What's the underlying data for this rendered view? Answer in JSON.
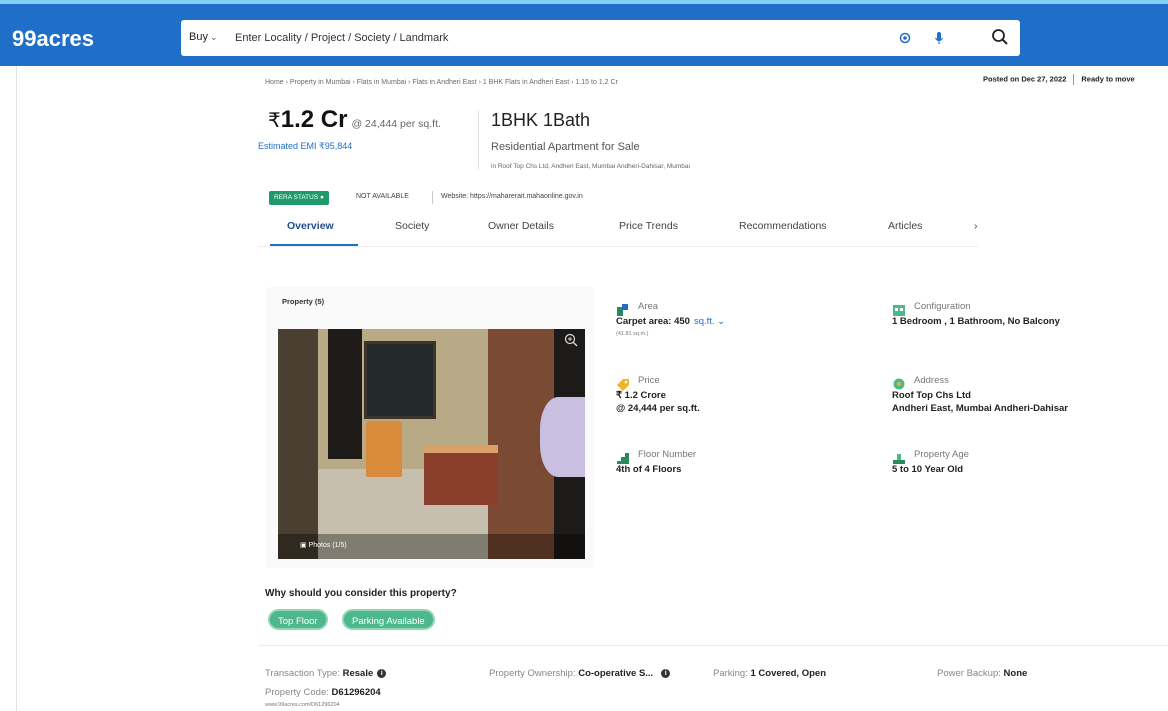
{
  "header": {
    "logo": "99acres",
    "buy_label": "Buy",
    "search_placeholder": "Enter Locality / Project / Society / Landmark"
  },
  "breadcrumb": "Home › Property in Mumbai › Flats in Mumbai › Flats in Andheri East › 1 BHK Flats in Andheri East › 1.15 to 1.2 Cr",
  "posted": {
    "date": "Posted on Dec 27, 2022",
    "status": "Ready to move"
  },
  "price": {
    "amount": "1.2 Cr",
    "rupee": "₹",
    "per_sqft": "@ 24,444 per sq.ft.",
    "emi": "Estimated EMI ₹95,844"
  },
  "listing": {
    "title": "1BHK 1Bath",
    "subtitle": "Residential Apartment for Sale",
    "address": "in Roof Top Chs Ltd, Andheri East, Mumbai Andheri-Dahisar, Mumbai"
  },
  "rera": {
    "badge": "RERA STATUS",
    "status": "NOT AVAILABLE",
    "website": "Website: https://maharerait.mahaonline.gov.in"
  },
  "tabs": [
    "Overview",
    "Society",
    "Owner Details",
    "Price Trends",
    "Recommendations",
    "Articles",
    "›"
  ],
  "photos": {
    "label": "Property (5)",
    "caption": "Photos (1/5)"
  },
  "facts": {
    "area": {
      "label": "Area",
      "value": "Carpet area: 450",
      "unit": "sq.ft.",
      "sub": "(41.81 sq.m.)"
    },
    "configuration": {
      "label": "Configuration",
      "value": "1 Bedroom , 1 Bathroom, No Balcony"
    },
    "price": {
      "label": "Price",
      "value": "₹ 1.2 Crore",
      "value2": "@ 24,444 per sq.ft."
    },
    "address": {
      "label": "Address",
      "value": "Roof Top Chs Ltd",
      "value2": "Andheri East, Mumbai Andheri-Dahisar"
    },
    "floor": {
      "label": "Floor Number",
      "value": "4th of 4 Floors"
    },
    "age": {
      "label": "Property Age",
      "value": "5 to 10 Year Old"
    }
  },
  "why": {
    "title": "Why should you consider this property?",
    "chips": [
      "Top Floor",
      "Parking Available"
    ]
  },
  "info": {
    "transaction_label": "Transaction Type:",
    "transaction_value": "Resale",
    "ownership_label": "Property Ownership:",
    "ownership_value": "Co-operative S...",
    "parking_label": "Parking:",
    "parking_value": "1 Covered, Open",
    "power_label": "Power Backup:",
    "power_value": "None",
    "code_label": "Property Code:",
    "code_value": "D61296204",
    "url": "www.99acres.com/D61296204"
  },
  "colors": {
    "header": "#1f6fc9",
    "accent_green": "#1e9a6b",
    "chip_green": "#4db88b"
  }
}
